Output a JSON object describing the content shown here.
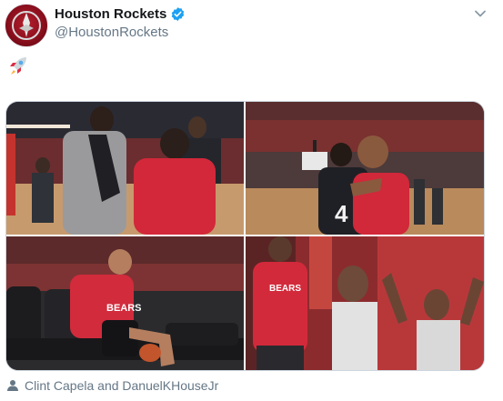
{
  "tweet": {
    "display_name": "Houston Rockets",
    "handle": "@HoustonRockets",
    "verified": true,
    "emoji": "rocket-icon",
    "tagged_people": "Clint Capela and DanuelKHouseJr"
  },
  "photos": [
    {
      "jersey_text": ""
    },
    {
      "jersey_text": "4"
    },
    {
      "jersey_text": "BEARS"
    },
    {
      "jersey_text": "BEARS"
    }
  ],
  "colors": {
    "brand_red": "#ce1141",
    "verified_blue": "#1da1f2",
    "secondary_text": "#657786"
  }
}
